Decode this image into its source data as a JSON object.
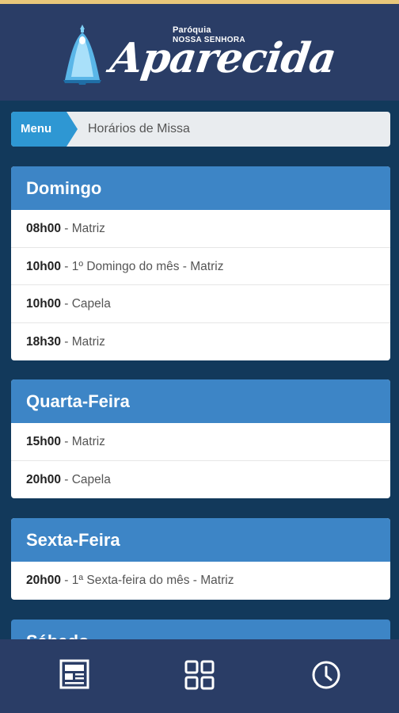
{
  "header": {
    "logo_small1": "Paróquia",
    "logo_small2": "NOSSA SENHORA",
    "logo_script": "Aparecida"
  },
  "breadcrumb": {
    "menu_label": "Menu",
    "current": "Horários de Missa"
  },
  "days": [
    {
      "title": "Domingo",
      "items": [
        {
          "time": "08h00",
          "desc": " - Matriz"
        },
        {
          "time": "10h00",
          "desc": " - 1º Domingo do mês - Matriz"
        },
        {
          "time": "10h00",
          "desc": " - Capela"
        },
        {
          "time": "18h30",
          "desc": " - Matriz"
        }
      ]
    },
    {
      "title": "Quarta-Feira",
      "items": [
        {
          "time": "15h00",
          "desc": " - Matriz"
        },
        {
          "time": "20h00",
          "desc": " - Capela"
        }
      ]
    },
    {
      "title": "Sexta-Feira",
      "items": [
        {
          "time": "20h00",
          "desc": " - 1ª Sexta-feira do mês - Matriz"
        }
      ]
    },
    {
      "title": "Sábado",
      "items": []
    }
  ],
  "bottom_nav": {
    "icons": [
      "news-icon",
      "grid-icon",
      "clock-icon"
    ]
  },
  "colors": {
    "header_bg": "#2a3d66",
    "content_bg": "#12395b",
    "card_header": "#3d85c6",
    "menu_badge": "#2e97d3"
  }
}
